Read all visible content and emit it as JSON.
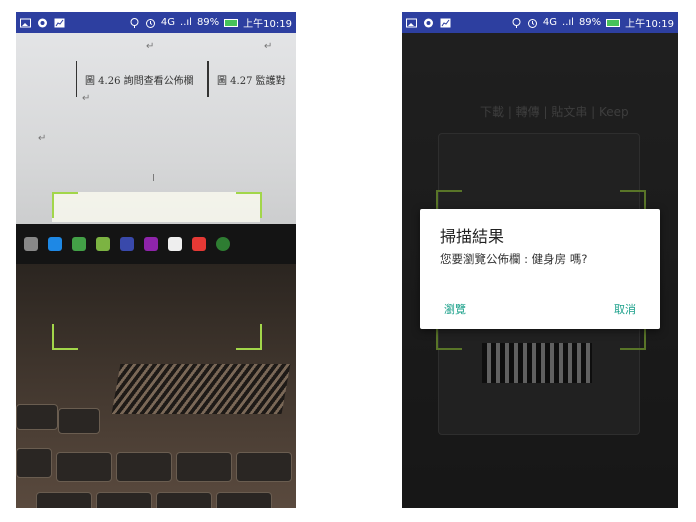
{
  "statusbar": {
    "network": "4G",
    "signal": "..ıl",
    "battery_percent": "89%",
    "time": "上午10:19",
    "icons": [
      "gallery-icon",
      "record-icon",
      "chart-icon",
      "location-icon",
      "alarm-icon",
      "battery-icon"
    ]
  },
  "scanner": {
    "doc_caption_left": "圖 4.26 詢問查看公佈欄",
    "doc_caption_right": "圖 4.27 監護對",
    "frame_color": "#a2d64a"
  },
  "background_app": {
    "header_text": "下載 | 轉傳 | 貼文串 | Keep"
  },
  "dialog": {
    "title": "掃描結果",
    "message": "您要瀏覽公佈欄 : 健身房 嗎?",
    "confirm_label": "瀏覽",
    "cancel_label": "取消",
    "accent_color": "#1aa08a"
  }
}
